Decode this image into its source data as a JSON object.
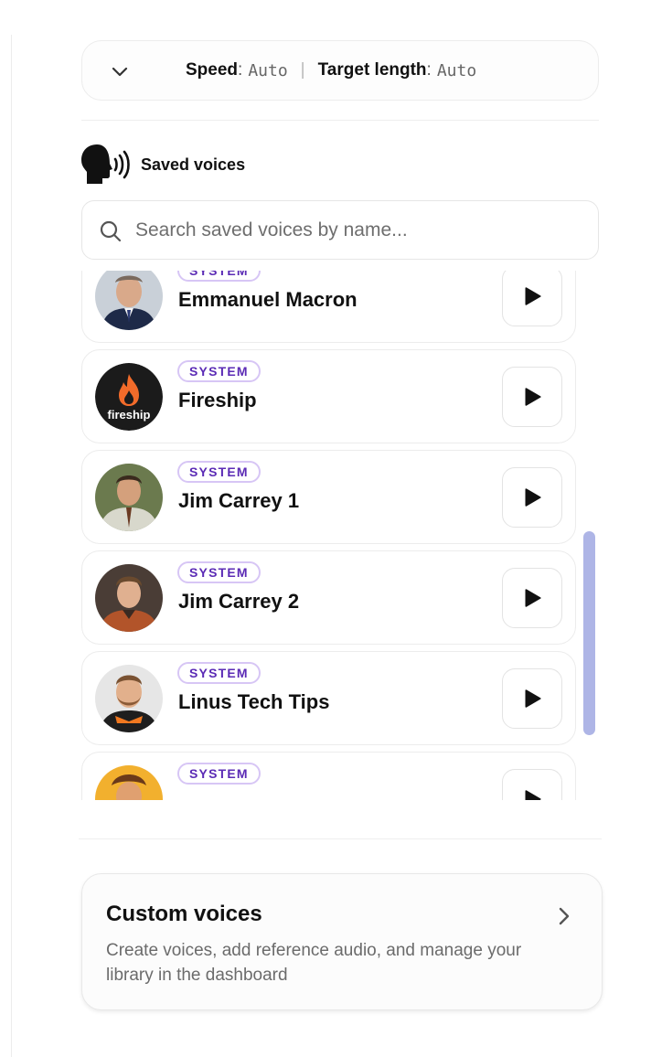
{
  "speed_panel": {
    "speed_label": "Speed",
    "speed_value": "Auto",
    "target_label": "Target length",
    "target_value": "Auto",
    "colon": ":",
    "separator": "|"
  },
  "saved_voices": {
    "title": "Saved voices",
    "search_placeholder": "Search saved voices by name..."
  },
  "voices": [
    {
      "name": "Emmanuel Macron",
      "badge": "SYSTEM",
      "avatar": "macron-avatar"
    },
    {
      "name": "Fireship",
      "badge": "SYSTEM",
      "avatar": "fireship-logo",
      "logo_text": "fireship"
    },
    {
      "name": "Jim Carrey 1",
      "badge": "SYSTEM",
      "avatar": "jim-carrey-1-avatar"
    },
    {
      "name": "Jim Carrey 2",
      "badge": "SYSTEM",
      "avatar": "jim-carrey-2-avatar"
    },
    {
      "name": "Linus Tech Tips",
      "badge": "SYSTEM",
      "avatar": "linus-avatar"
    },
    {
      "name": "",
      "badge": "SYSTEM",
      "avatar": "cartoon-avatar"
    }
  ],
  "custom_voices": {
    "title": "Custom voices",
    "description": "Create voices, add reference audio, and manage your library in the dashboard"
  },
  "colors": {
    "badge_text": "#5b2bb5",
    "badge_border": "#d7c6f5",
    "scrollbar": "#aeb5e6",
    "fireship_flame": "#f26b2a"
  },
  "icons": [
    "chevron-down-icon",
    "speaking-head-icon",
    "search-icon",
    "play-icon",
    "chevron-right-icon"
  ]
}
